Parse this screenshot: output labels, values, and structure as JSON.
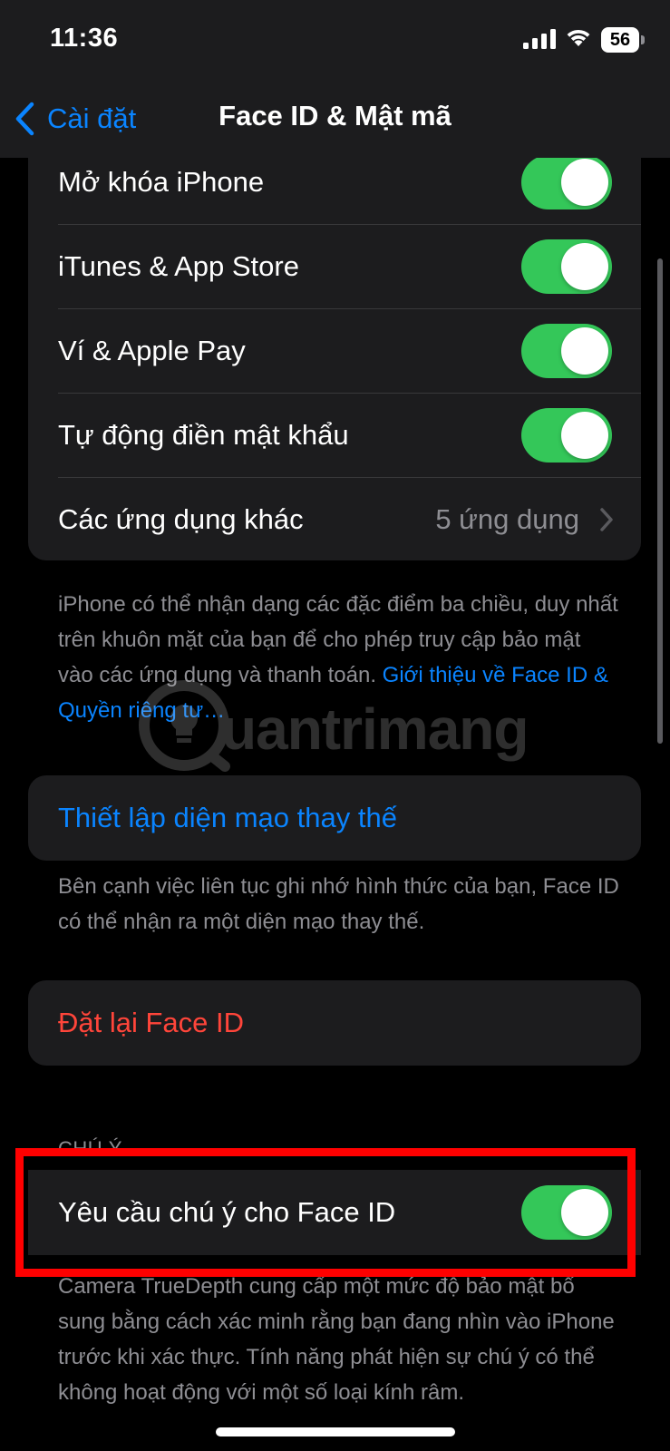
{
  "status_bar": {
    "time": "11:36",
    "battery": "56"
  },
  "nav": {
    "back_label": "Cài đặt",
    "title": "Face ID & Mật mã"
  },
  "use_face_id_for": {
    "items": [
      {
        "label": "Mở khóa iPhone",
        "toggle_on": true
      },
      {
        "label": "iTunes & App Store",
        "toggle_on": true
      },
      {
        "label": "Ví & Apple Pay",
        "toggle_on": true
      },
      {
        "label": "Tự động điền mật khẩu",
        "toggle_on": true
      }
    ],
    "other_apps": {
      "label": "Các ứng dụng khác",
      "value": "5 ứng dụng"
    },
    "footer_text": "iPhone có thể nhận dạng các đặc điểm ba chiều, duy nhất trên khuôn mặt của bạn để cho phép truy cập bảo mật vào các ứng dụng và thanh toán.",
    "footer_link": "Giới thiệu về Face ID & Quyền riêng tư…"
  },
  "alternate_appearance": {
    "label": "Thiết lập diện mạo thay thế",
    "footer_text": "Bên cạnh việc liên tục ghi nhớ hình thức của bạn, Face ID có thể nhận ra một diện mạo thay thế."
  },
  "reset": {
    "label": "Đặt lại Face ID"
  },
  "attention": {
    "header": "CHÚ Ý",
    "label": "Yêu cầu chú ý cho Face ID",
    "toggle_on": true,
    "footer_text": "Camera TrueDepth cung cấp một mức độ bảo mật bổ sung bằng cách xác minh rằng bạn đang nhìn vào iPhone trước khi xác thực. Tính năng phát hiện sự chú ý có thể không hoạt động với một số loại kính râm."
  },
  "watermark": "uantrimang",
  "colors": {
    "background": "#000000",
    "cell": "#1c1c1e",
    "accent_blue": "#0a84ff",
    "toggle_green": "#34c759",
    "destructive_red": "#ff453a",
    "secondary_text": "#8e8e93",
    "highlight_red": "#ff0000"
  },
  "icons": [
    "signal-icon",
    "wifi-icon",
    "battery-icon",
    "chevron-left-icon",
    "chevron-right-icon",
    "lightbulb-logo-icon"
  ]
}
